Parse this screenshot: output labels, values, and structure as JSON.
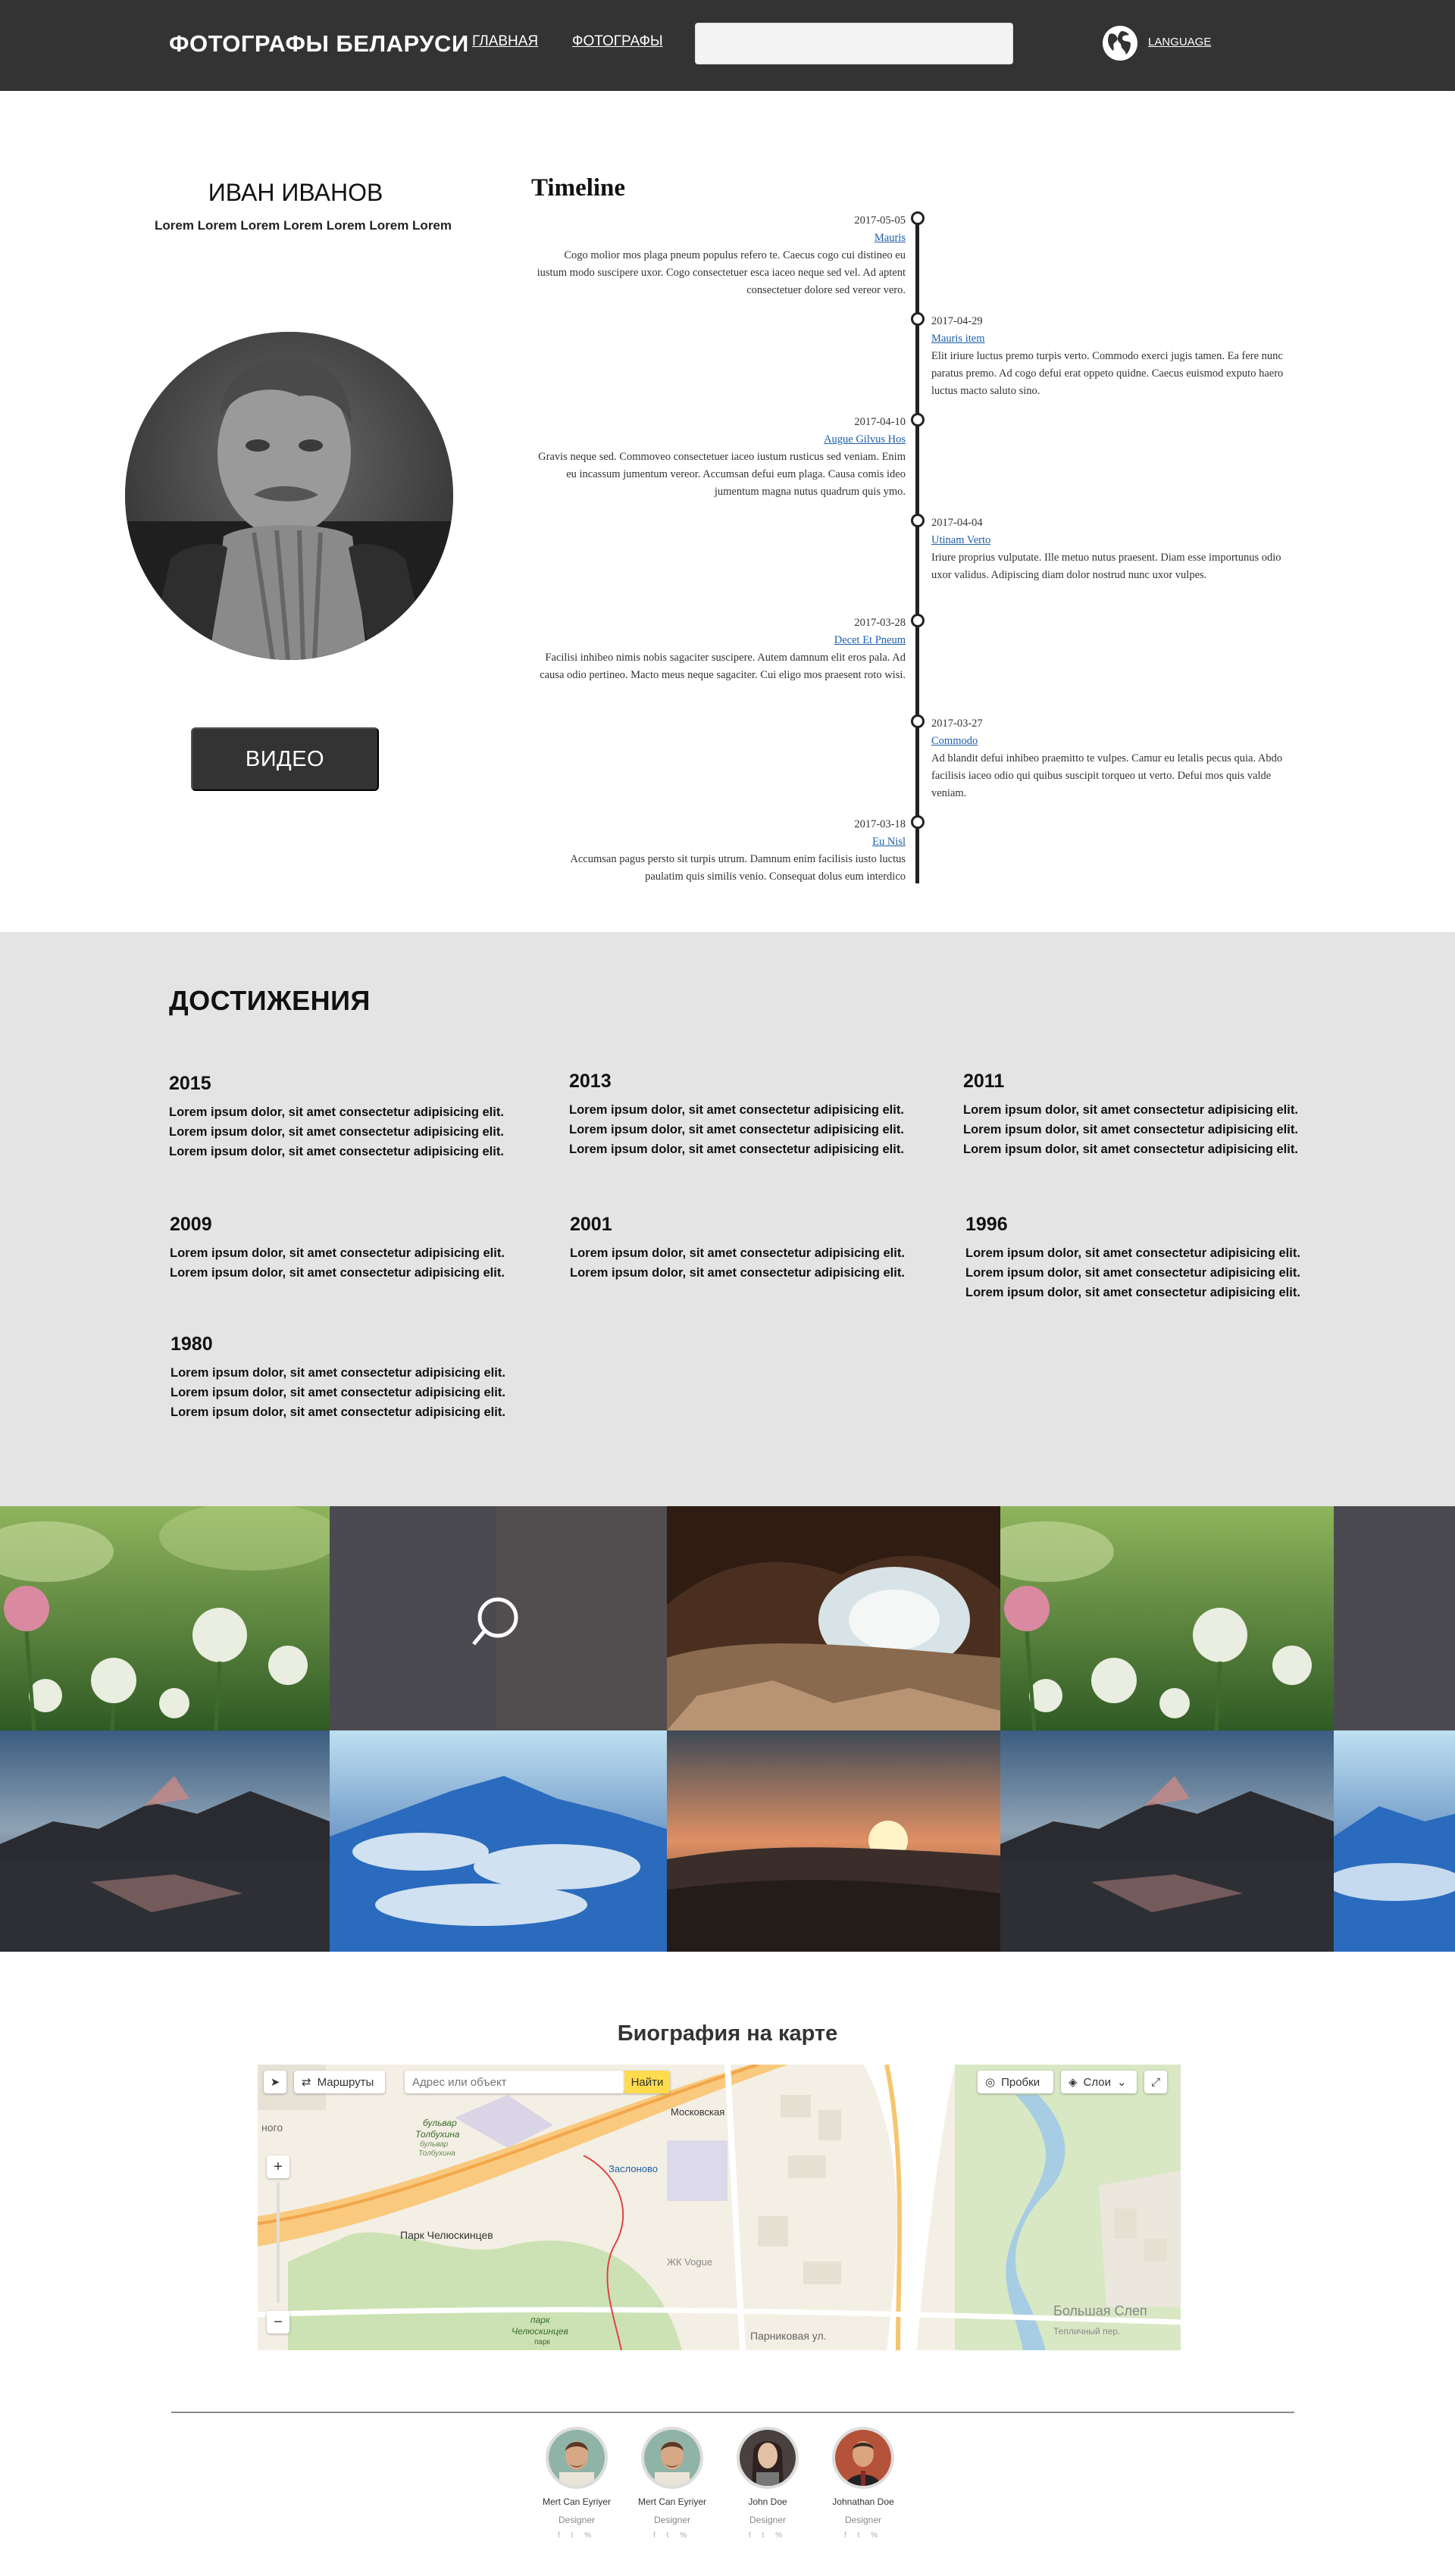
{
  "header": {
    "brand": "ФОТОГРАФЫ БЕЛАРУСИ",
    "nav": [
      "ГЛАВНАЯ",
      "ФОТОГРАФЫ"
    ],
    "search_value": "",
    "language": "LANGUAGE"
  },
  "profile": {
    "name": "ИВАН ИВАНОВ",
    "subtitle": "Lorem Lorem Lorem Lorem Lorem Lorem Lorem",
    "video_label": "ВИДЕО"
  },
  "timeline": {
    "title": "Timeline",
    "items": [
      {
        "date": "2017-05-05",
        "heading": "Mauris",
        "text": "Cogo molior mos plaga pneum populus refero te. Caecus cogo cui distineo eu iustum modo suscipere uxor. Cogo consectetuer esca iaceo neque sed vel. Ad aptent consectetuer dolore sed vereor vero."
      },
      {
        "date": "2017-04-29",
        "heading": "Mauris item",
        "text": "Elit iriure luctus premo turpis verto. Commodo exerci jugis tamen. Ea fere nunc paratus premo. Ad cogo defui erat oppeto quidne. Caecus euismod exputo haero luctus macto saluto sino."
      },
      {
        "date": "2017-04-10",
        "heading": "Augue Gilvus Hos",
        "text": "Gravis neque sed. Commoveo consectetuer iaceo iustum rusticus sed veniam. Enim eu incassum jumentum vereor. Accumsan defui eum plaga. Causa comis ideo jumentum magna nutus quadrum quis ymo."
      },
      {
        "date": "2017-04-04",
        "heading": "Utinam Verto",
        "text": "Iriure proprius vulputate. Ille metuo nutus praesent. Diam esse importunus odio uxor validus. Adipiscing diam dolor nostrud nunc uxor vulpes."
      },
      {
        "date": "2017-03-28",
        "heading": "Decet Et Pneum",
        "text": "Facilisi inhibeo nimis nobis sagaciter suscipere. Autem damnum elit eros pala. Ad causa odio pertineo. Macto meus neque sagaciter. Cui eligo mos praesent roto wisi."
      },
      {
        "date": "2017-03-27",
        "heading": "Commodo",
        "text": "Ad blandit defui inhibeo praemitto te vulpes. Camur eu letalis pecus quia. Abdo facilisis iaceo odio qui quibus suscipit torqueo ut verto. Defui mos quis valde veniam."
      },
      {
        "date": "2017-03-18",
        "heading": "Eu Nisl",
        "text": "Accumsan pagus persto sit turpis utrum. Damnum enim facilisis iusto luctus paulatim quis similis venio. Consequat dolus eum interdico"
      }
    ]
  },
  "achievements": {
    "title": "ДОСТИЖЕНИЯ",
    "items": [
      {
        "year": "2015",
        "lines": [
          "Lorem ipsum dolor, sit amet consectetur adipisicing elit.",
          "Lorem ipsum dolor, sit amet consectetur adipisicing elit.",
          "Lorem ipsum dolor, sit amet consectetur adipisicing elit."
        ]
      },
      {
        "year": "2013",
        "lines": [
          "Lorem ipsum dolor, sit amet consectetur adipisicing elit.",
          "Lorem ipsum dolor, sit amet consectetur adipisicing elit.",
          "Lorem ipsum dolor, sit amet consectetur adipisicing elit."
        ]
      },
      {
        "year": "2011",
        "lines": [
          "Lorem ipsum dolor, sit amet consectetur adipisicing elit.",
          "Lorem ipsum dolor, sit amet consectetur adipisicing elit.",
          "Lorem ipsum dolor, sit amet consectetur adipisicing elit."
        ]
      },
      {
        "year": "2009",
        "lines": [
          "Lorem ipsum dolor, sit amet consectetur adipisicing elit.",
          "Lorem ipsum dolor, sit amet consectetur adipisicing elit."
        ]
      },
      {
        "year": "2001",
        "lines": [
          "Lorem ipsum dolor, sit amet consectetur adipisicing elit.",
          "Lorem ipsum dolor, sit amet consectetur adipisicing elit."
        ]
      },
      {
        "year": "1996",
        "lines": [
          "Lorem ipsum dolor, sit amet consectetur adipisicing elit.",
          "Lorem ipsum dolor, sit amet consectetur adipisicing elit.",
          "Lorem ipsum dolor, sit amet consectetur adipisicing elit."
        ]
      },
      {
        "year": "1980",
        "lines": [
          "Lorem ipsum dolor, sit amet consectetur adipisicing elit.",
          "Lorem ipsum dolor, sit amet consectetur adipisicing elit.",
          "Lorem ipsum dolor, sit amet consectetur adipisicing elit."
        ]
      }
    ]
  },
  "gallery": {
    "icons": [
      "search-icon"
    ]
  },
  "map": {
    "title": "Биография на карте",
    "routes_label": "Маршруты",
    "search_placeholder": "Адрес или объект",
    "find_label": "Найти",
    "traffic_label": "Пробки",
    "layers_label": "Слои",
    "labels": {
      "moskovskaya": "Московская",
      "zaslonovo": "Заслоново",
      "park_chelyuskintsev": "Парк Челюскинцев",
      "zhk_vogue": "ЖК Vogue",
      "park_label_1": "парк",
      "park_label_2": "Челюскинцев",
      "park_label_3": "парк",
      "bulvar_1": "бульвар",
      "bulvar_2": "Толбухина",
      "bulvar_3": "бульвар",
      "bulvar_4": "Толбухина",
      "bolshaya": "Большая Слеп",
      "tepl_street": "Тепличный пер.",
      "parkovaya": "Парниковая ул.",
      "left_edge": "ного"
    }
  },
  "team": [
    {
      "name": "Mert Can Eyriyer",
      "role": "Designer",
      "social": "f t %"
    },
    {
      "name": "Mert Can Eyriyer",
      "role": "Designer",
      "social": "f t %"
    },
    {
      "name": "John Doe",
      "role": "Designer",
      "social": "f t %"
    },
    {
      "name": "Johnathan Doe",
      "role": "Designer",
      "social": "f t %"
    }
  ]
}
